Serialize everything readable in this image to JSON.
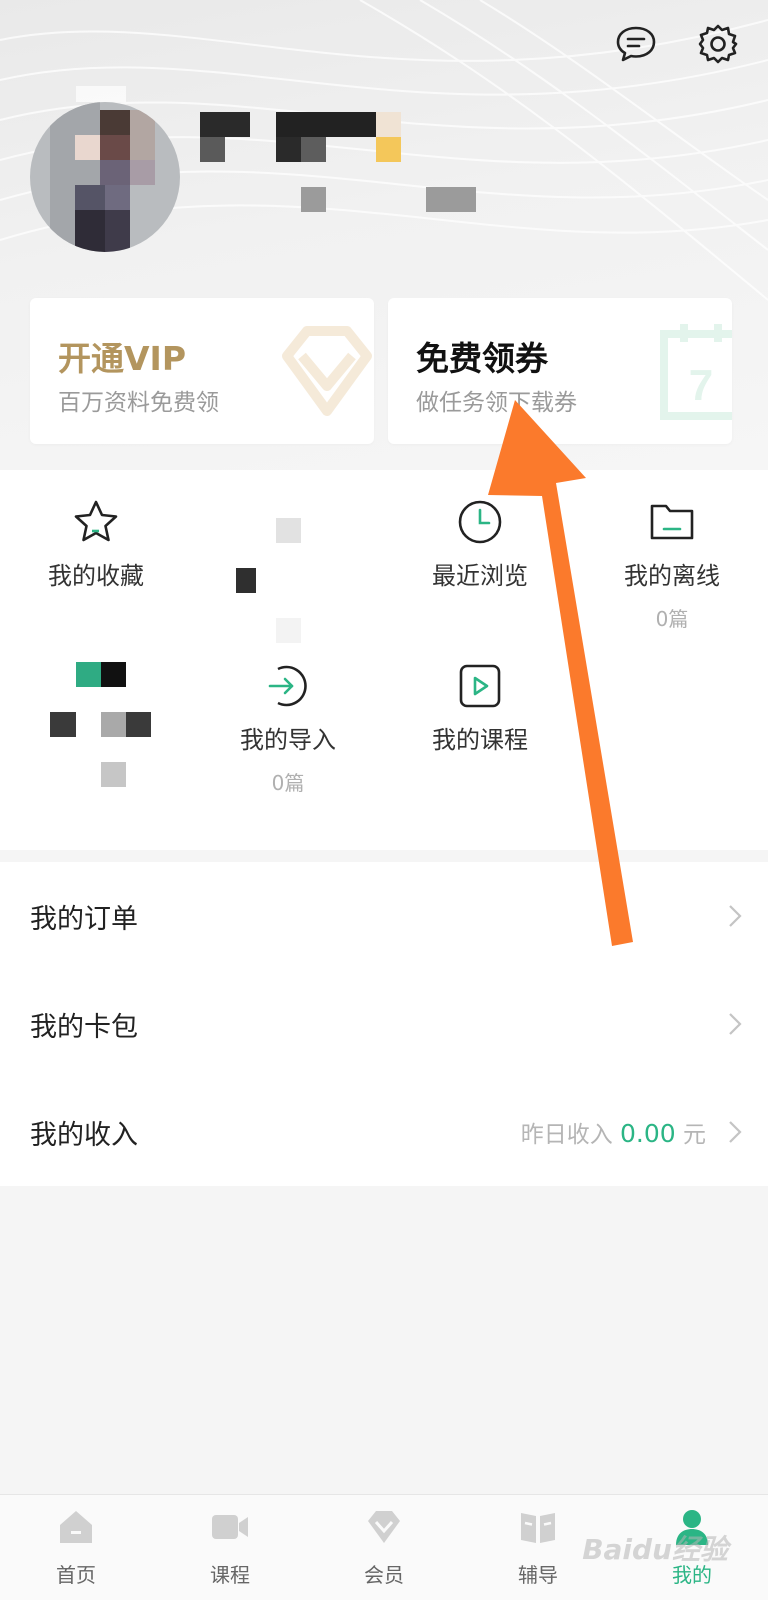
{
  "header": {
    "message_icon": "message-icon",
    "settings_icon": "gear-icon"
  },
  "cards": {
    "vip": {
      "title": "开通VIP",
      "subtitle": "百万资料免费领",
      "title_color": "#b3955e"
    },
    "coupon": {
      "title": "免费领券",
      "subtitle": "做任务领下载券"
    }
  },
  "grid": {
    "favorites": {
      "label": "我的收藏",
      "icon": "star-icon"
    },
    "recent": {
      "label": "最近浏览",
      "icon": "clock-icon"
    },
    "offline": {
      "label": "我的离线",
      "count": "0篇",
      "icon": "folder-icon"
    },
    "imports": {
      "label": "我的导入",
      "count": "0篇",
      "icon": "import-icon"
    },
    "courses": {
      "label": "我的课程",
      "icon": "play-icon"
    }
  },
  "list": {
    "orders": {
      "label": "我的订单"
    },
    "wallet": {
      "label": "我的卡包"
    },
    "income": {
      "label": "我的收入",
      "prefix": "昨日收入",
      "amount": "0.00",
      "unit": "元"
    }
  },
  "nav": {
    "items": [
      {
        "label": "首页",
        "icon": "home-icon"
      },
      {
        "label": "课程",
        "icon": "video-icon"
      },
      {
        "label": "会员",
        "icon": "diamond-icon"
      },
      {
        "label": "辅导",
        "icon": "book-icon"
      },
      {
        "label": "我的",
        "icon": "user-icon"
      }
    ],
    "active_index": 4
  },
  "watermark": "Baidu经验",
  "colors": {
    "accent": "#2bb585",
    "vip_gold": "#b3955e",
    "annotation_arrow": "#fb7a2c"
  }
}
